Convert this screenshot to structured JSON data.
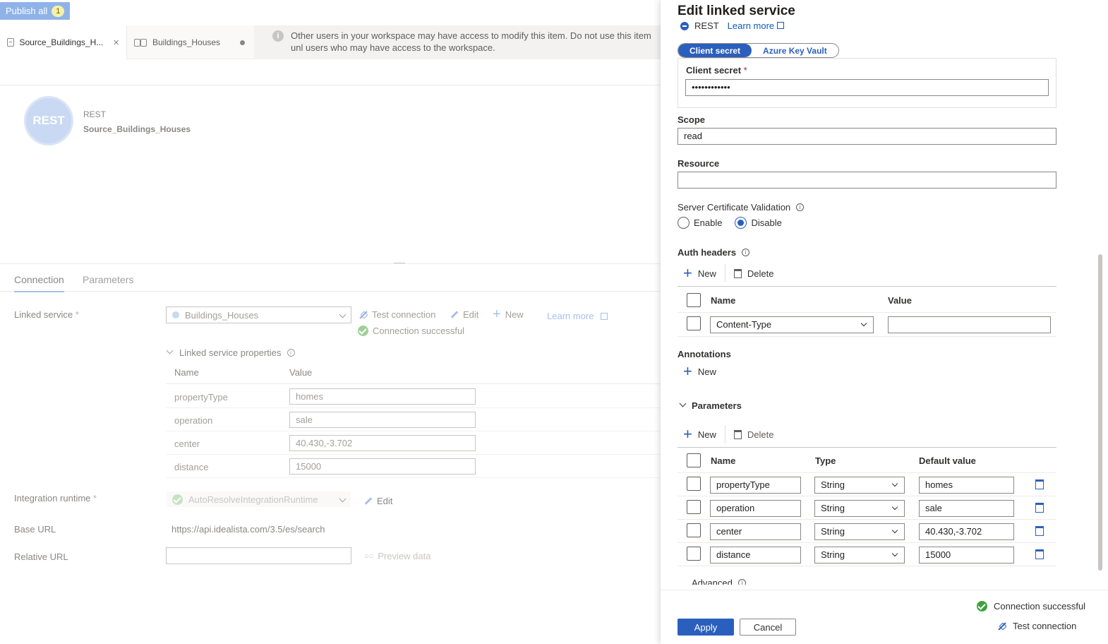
{
  "toolbar": {
    "publish_label": "Publish all",
    "publish_count": "1"
  },
  "tabs": [
    {
      "label": "Source_Buildings_H...",
      "icon": "table-icon"
    },
    {
      "label": "Buildings_Houses",
      "icon": "glasses-icon"
    }
  ],
  "info_banner": {
    "text": "Other users in your workspace may have access to modify this item. Do not use this item unl users who may have access to the workspace."
  },
  "dataset": {
    "type": "REST",
    "name": "Source_Buildings_Houses",
    "logo_text": "REST"
  },
  "connection_tabs": [
    "Connection",
    "Parameters"
  ],
  "connection": {
    "linked_service_label": "Linked service",
    "linked_service_value": "Buildings_Houses",
    "test_connection": "Test connection",
    "edit": "Edit",
    "new": "New",
    "learn_more": "Learn more",
    "status": "Connection successful",
    "props_header": "Linked service properties",
    "props_cols": [
      "Name",
      "Value"
    ],
    "props": [
      {
        "name": "propertyType",
        "value": "homes"
      },
      {
        "name": "operation",
        "value": "sale"
      },
      {
        "name": "center",
        "value": "40.430,-3.702"
      },
      {
        "name": "distance",
        "value": "15000"
      }
    ],
    "ir_label": "Integration runtime",
    "ir_value": "AutoResolveIntegrationRuntime",
    "ir_edit": "Edit",
    "base_url_label": "Base URL",
    "base_url_value": "https://api.idealista.com/3.5/es/search",
    "relative_url_label": "Relative URL",
    "preview_data": "Preview data"
  },
  "panel": {
    "title": "Edit linked service",
    "service_type": "REST",
    "learn_more": "Learn more",
    "secret_toggle": [
      "Client secret",
      "Azure Key Vault"
    ],
    "client_secret_label": "Client secret",
    "client_secret_value": "••••••••••••",
    "scope_label": "Scope",
    "scope_value": "read",
    "resource_label": "Resource",
    "resource_value": "",
    "cert_label": "Server Certificate Validation",
    "cert_options": [
      "Enable",
      "Disable"
    ],
    "auth_headers_label": "Auth headers",
    "new_label": "New",
    "delete_label": "Delete",
    "auth_cols": [
      "Name",
      "Value"
    ],
    "auth_row": {
      "name": "Content-Type",
      "value": ""
    },
    "annotations_label": "Annotations",
    "parameters_label": "Parameters",
    "param_cols": [
      "Name",
      "Type",
      "Default value"
    ],
    "params": [
      {
        "name": "propertyType",
        "type": "String",
        "default": "homes"
      },
      {
        "name": "operation",
        "type": "String",
        "default": "sale"
      },
      {
        "name": "center",
        "type": "String",
        "default": "40.430,-3.702"
      },
      {
        "name": "distance",
        "type": "String",
        "default": "15000"
      }
    ],
    "advanced_label": "Advanced",
    "apply": "Apply",
    "cancel": "Cancel",
    "status": "Connection successful",
    "test_connection": "Test connection"
  }
}
